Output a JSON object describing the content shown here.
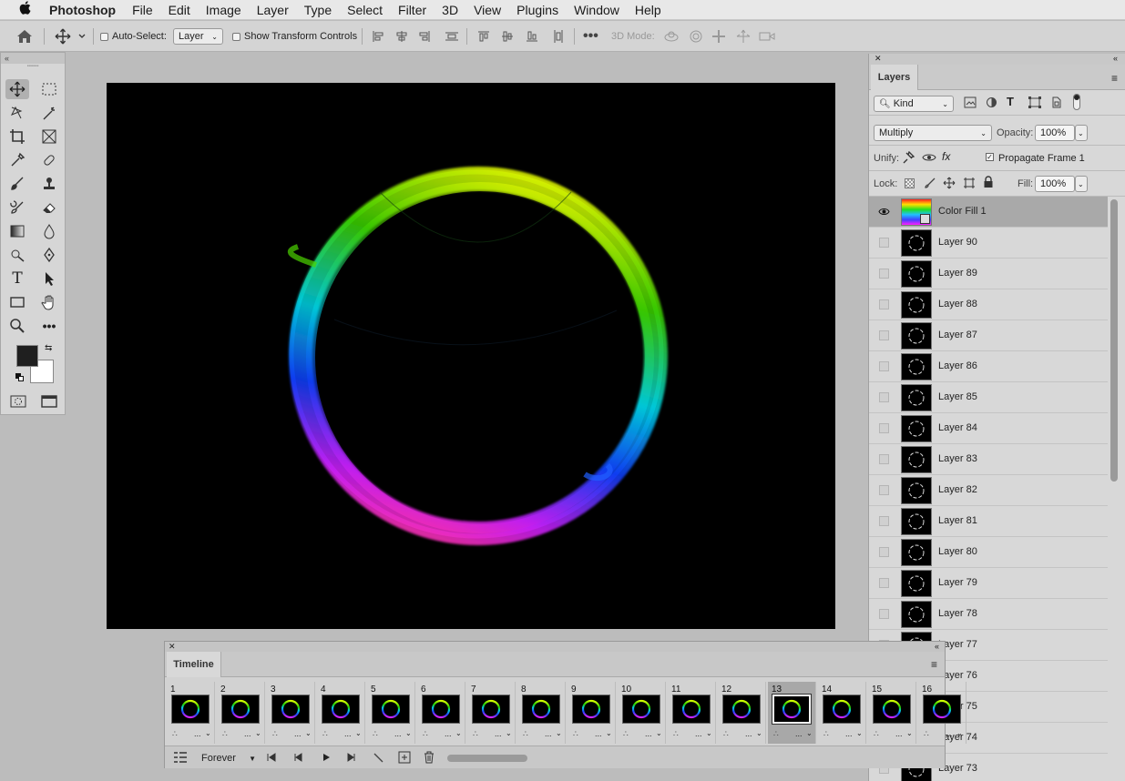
{
  "menubar": {
    "app_name": "Photoshop",
    "items": [
      "File",
      "Edit",
      "Image",
      "Layer",
      "Type",
      "Select",
      "Filter",
      "3D",
      "View",
      "Plugins",
      "Window",
      "Help"
    ]
  },
  "options_bar": {
    "auto_select_label": "Auto-Select:",
    "auto_select_value": "Layer",
    "show_transform_label": "Show Transform Controls",
    "three_d_mode_label": "3D Mode:"
  },
  "layers_panel": {
    "tab_label": "Layers",
    "filter_kind": "Kind",
    "blend_mode": "Multiply",
    "opacity_label": "Opacity:",
    "opacity_value": "100%",
    "unify_label": "Unify:",
    "propagate_label": "Propagate Frame 1",
    "lock_label": "Lock:",
    "fill_label": "Fill:",
    "fill_value": "100%",
    "layers": [
      {
        "name": "Color Fill 1",
        "visible": true,
        "selected": true
      },
      {
        "name": "Layer 90"
      },
      {
        "name": "Layer 89"
      },
      {
        "name": "Layer 88"
      },
      {
        "name": "Layer 87"
      },
      {
        "name": "Layer 86"
      },
      {
        "name": "Layer 85"
      },
      {
        "name": "Layer 84"
      },
      {
        "name": "Layer 83"
      },
      {
        "name": "Layer 82"
      },
      {
        "name": "Layer 81"
      },
      {
        "name": "Layer 80"
      },
      {
        "name": "Layer 79"
      },
      {
        "name": "Layer 78"
      },
      {
        "name": "Layer 77"
      },
      {
        "name": "Layer 76"
      },
      {
        "name": "Layer 75"
      },
      {
        "name": "Layer 74"
      },
      {
        "name": "Layer 73"
      }
    ]
  },
  "timeline": {
    "tab_label": "Timeline",
    "loop_value": "Forever",
    "current_frame": 13,
    "frames": [
      "1",
      "2",
      "3",
      "4",
      "5",
      "6",
      "7",
      "8",
      "9",
      "10",
      "11",
      "12",
      "13",
      "14",
      "15",
      "16"
    ],
    "frame_delay": "..."
  },
  "colors": {
    "foreground": "#1f1f1f",
    "background": "#ffffff"
  }
}
